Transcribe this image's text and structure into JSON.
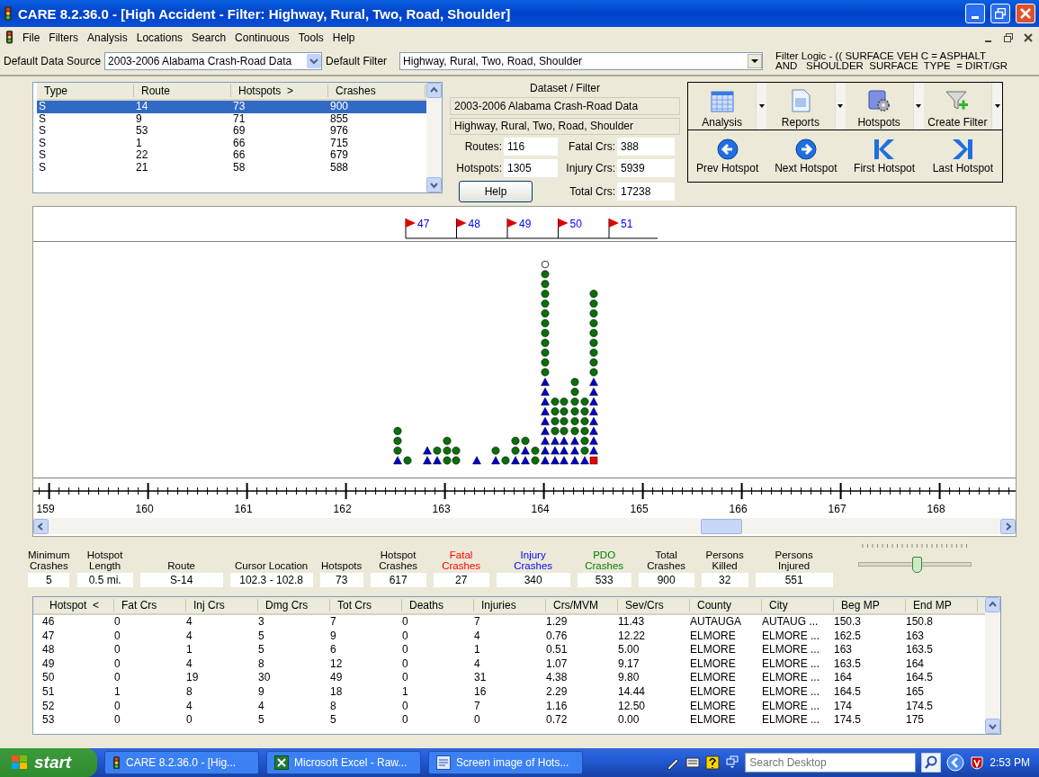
{
  "window": {
    "title": "CARE 8.2.36.0 - [High Accident - Filter:  Highway, Rural, Two, Road, Shoulder]"
  },
  "menu": [
    "File",
    "Filters",
    "Analysis",
    "Locations",
    "Search",
    "Continuous",
    "Tools",
    "Help"
  ],
  "toolbar": {
    "data_source_label": "Default Data Source",
    "data_source": "2003-2006 Alabama Crash-Road Data",
    "filter_label": "Default Filter",
    "filter": "Highway, Rural, Two, Road, Shoulder",
    "filter_logic": [
      "Filter Logic - (( SURFACE VEH C = ASPHALT",
      "AND   SHOULDER  SURFACE  TYPE  = DIRT/GR"
    ]
  },
  "routes": {
    "columns": [
      "Type",
      "Route",
      "Hotspots  >",
      "Crashes"
    ],
    "rows": [
      {
        "cells": [
          "S",
          "14",
          "73",
          "900"
        ],
        "selected": true
      },
      {
        "cells": [
          "S",
          "9",
          "71",
          "855"
        ],
        "selected": false
      },
      {
        "cells": [
          "S",
          "53",
          "69",
          "976"
        ],
        "selected": false
      },
      {
        "cells": [
          "S",
          "1",
          "66",
          "715"
        ],
        "selected": false
      },
      {
        "cells": [
          "S",
          "22",
          "66",
          "679"
        ],
        "selected": false
      },
      {
        "cells": [
          "S",
          "21",
          "58",
          "588"
        ],
        "selected": false
      }
    ]
  },
  "dataset": {
    "title": "Dataset / Filter",
    "dataset": "2003-2006 Alabama Crash-Road Data",
    "filter": "Highway, Rural, Two, Road, Shoulder",
    "fields": [
      {
        "label": "Routes:",
        "value": "116"
      },
      {
        "label": "Fatal Crs:",
        "value": "388"
      },
      {
        "label": "Hotspots:",
        "value": "1305"
      },
      {
        "label": "Injury Crs:",
        "value": "5939"
      },
      {
        "label": "Total Crs:",
        "value": "17238"
      }
    ],
    "help": "Help"
  },
  "tools": [
    {
      "label": "Analysis",
      "kind": "analysis"
    },
    {
      "label": "Reports",
      "kind": "reports"
    },
    {
      "label": "Hotspots",
      "kind": "hotspots"
    },
    {
      "label": "Create Filter",
      "kind": "filter"
    }
  ],
  "navigation": [
    {
      "label": "Prev Hotspot",
      "kind": "prev"
    },
    {
      "label": "Next Hotspot",
      "kind": "next"
    },
    {
      "label": "First Hotspot",
      "kind": "first"
    },
    {
      "label": "Last Hotspot",
      "kind": "last"
    }
  ],
  "chart": {
    "flags": [
      "47",
      "48",
      "49",
      "50",
      "51"
    ],
    "axis_labels": [
      "159",
      "160",
      "161",
      "162",
      "163",
      "164",
      "165",
      "166",
      "167",
      "168"
    ]
  },
  "stats": [
    {
      "label": [
        "Minimum",
        "Crashes"
      ],
      "value": "5",
      "color": "#000000"
    },
    {
      "label": [
        "Hotspot",
        "Length"
      ],
      "value": "0.5 mi.",
      "color": "#000000"
    },
    {
      "label": [
        "Route"
      ],
      "value": "S-14",
      "color": "#000000"
    },
    {
      "label": [
        "Cursor Location"
      ],
      "value": "102.3 - 102.8",
      "color": "#000000"
    },
    {
      "label": [
        "Hotspots"
      ],
      "value": "73",
      "color": "#000000"
    },
    {
      "label": [
        "Hotspot",
        "Crashes"
      ],
      "value": "617",
      "color": "#000000"
    },
    {
      "label": [
        "Fatal",
        "Crashes"
      ],
      "value": "27",
      "color": "#ff0000"
    },
    {
      "label": [
        "Injury",
        "Crashes"
      ],
      "value": "340",
      "color": "#0000ff"
    },
    {
      "label": [
        "PDO",
        "Crashes"
      ],
      "value": "533",
      "color": "#008000"
    },
    {
      "label": [
        "Total",
        "Crashes"
      ],
      "value": "900",
      "color": "#000000"
    },
    {
      "label": [
        "Persons",
        "Killed"
      ],
      "value": "32",
      "color": "#000000"
    },
    {
      "label": [
        "Persons",
        "Injured"
      ],
      "value": "551",
      "color": "#000000"
    }
  ],
  "slider": {
    "level": 0.52
  },
  "hotspots": {
    "columns": [
      "Hotspot  <",
      "Fat Crs",
      "Inj Crs",
      "Dmg Crs",
      "Tot Crs",
      "Deaths",
      "Injuries",
      "Crs/MVM",
      "Sev/Crs",
      "County",
      "City",
      "Beg MP",
      "End MP"
    ],
    "rows": [
      [
        "46",
        "0",
        "4",
        "3",
        "7",
        "0",
        "7",
        "1.29",
        "11.43",
        "AUTAUGA",
        "AUTAUG ...",
        "150.3",
        "150.8"
      ],
      [
        "47",
        "0",
        "4",
        "5",
        "9",
        "0",
        "4",
        "0.76",
        "12.22",
        "ELMORE",
        "ELMORE ...",
        "162.5",
        "163"
      ],
      [
        "48",
        "0",
        "1",
        "5",
        "6",
        "0",
        "1",
        "0.51",
        "5.00",
        "ELMORE",
        "ELMORE ...",
        "163",
        "163.5"
      ],
      [
        "49",
        "0",
        "4",
        "8",
        "12",
        "0",
        "4",
        "1.07",
        "9.17",
        "ELMORE",
        "ELMORE ...",
        "163.5",
        "164"
      ],
      [
        "50",
        "0",
        "19",
        "30",
        "49",
        "0",
        "31",
        "4.38",
        "9.80",
        "ELMORE",
        "ELMORE ...",
        "164",
        "164.5"
      ],
      [
        "51",
        "1",
        "8",
        "9",
        "18",
        "1",
        "16",
        "2.29",
        "14.44",
        "ELMORE",
        "ELMORE ...",
        "164.5",
        "165"
      ],
      [
        "52",
        "0",
        "4",
        "4",
        "8",
        "0",
        "7",
        "1.16",
        "12.50",
        "ELMORE",
        "ELMORE ...",
        "174",
        "174.5"
      ],
      [
        "53",
        "0",
        "0",
        "5",
        "5",
        "0",
        "0",
        "0.72",
        "0.00",
        "ELMORE",
        "ELMORE ...",
        "174.5",
        "175"
      ]
    ]
  },
  "taskbar": {
    "start": "start",
    "tasks": [
      {
        "label": "CARE 8.2.36.0 - [Hig...",
        "kind": "care"
      },
      {
        "label": "Microsoft Excel - Raw...",
        "kind": "excel"
      },
      {
        "label": "Screen image of Hots...",
        "kind": "word"
      }
    ],
    "search_placeholder": "Search Desktop",
    "clock": "2:53 PM"
  }
}
